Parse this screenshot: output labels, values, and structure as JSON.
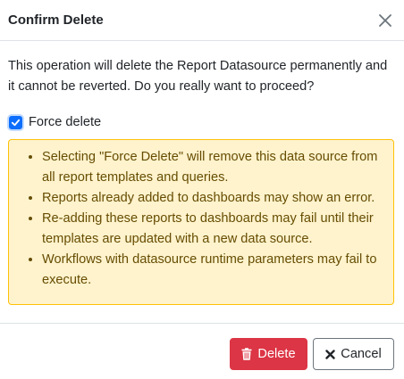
{
  "dialog": {
    "title": "Confirm Delete",
    "close_icon": "close-icon",
    "message": "This operation will delete the Report Datasource permanently and it cannot be reverted. Do you really want to proceed?",
    "force_delete": {
      "label": "Force delete",
      "checked": true
    },
    "warnings": [
      "Selecting \"Force Delete\" will remove this data source from all report templates and queries.",
      "Reports already added to dashboards may show an error.",
      "Re-adding these reports to dashboards may fail until their templates are updated with a new data source.",
      "Workflows with datasource runtime parameters may fail to execute."
    ]
  },
  "footer": {
    "delete_label": "Delete",
    "delete_icon": "trash-icon",
    "cancel_label": "Cancel",
    "cancel_icon": "x-icon"
  },
  "colors": {
    "danger": "#dc3545",
    "primary": "#0d6efd",
    "warning_bg": "#fff3cd",
    "warning_border": "#ffc107",
    "warning_text": "#664d03"
  }
}
